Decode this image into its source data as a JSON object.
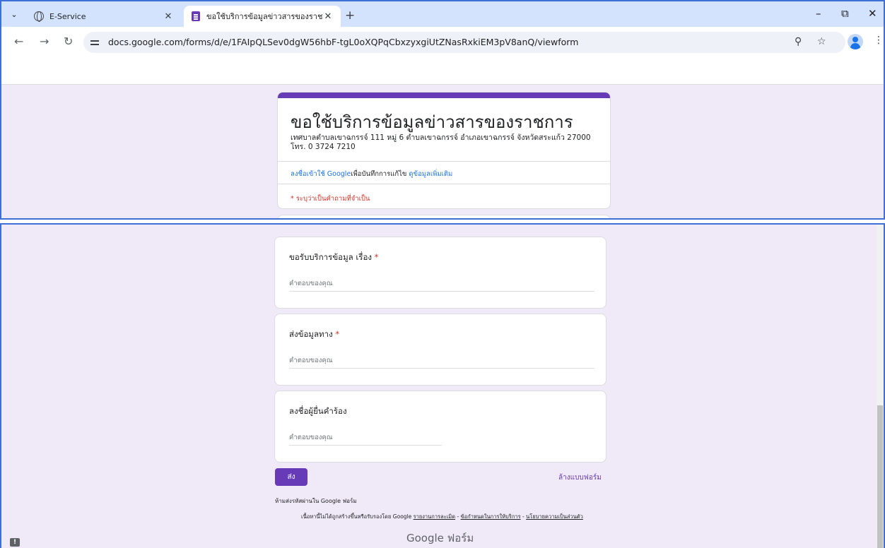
{
  "browser": {
    "tabs": [
      {
        "title": "E-Service",
        "icon": "globe-icon"
      },
      {
        "title": "ขอใช้บริการข้อมูลข่าวสารของราชการ",
        "icon": "forms-icon"
      }
    ],
    "new_tab": "+",
    "window_controls": {
      "minimize": "–",
      "restore": "⧉",
      "close": "✕"
    },
    "url": "docs.google.com/forms/d/e/1FAIpQLSev0dgW56hbF-tgL0oXQPqCbxzyxgiUtZNasRxkiEM3pV8anQ/viewform"
  },
  "form": {
    "title": "ขอใช้บริการข้อมูลข่าวสารของราชการ",
    "description_line1": "เทศบาลตำบลเขาฉกรรจ์  111 หมู่ 6 ตำบลเขาฉกรรจ์ อำเภอเขาฉกรรจ์ จังหวัดสระแก้ว 27000",
    "description_line2": "โทร. 0 3724 7210",
    "signin_link": "ลงชื่อเข้าใช้ Google",
    "signin_text": "เพื่อบันทึกการแก้ไข ",
    "learn_more": "ดูข้อมูลเพิ่มเติม",
    "required_note": "* ระบุว่าเป็นคำถามที่จำเป็น",
    "questions": [
      {
        "label": "ขอรับบริการข้อมูล เรื่อง",
        "required": "*",
        "placeholder": "คำตอบของคุณ"
      },
      {
        "label": "ส่งข้อมูลทาง",
        "required": "*",
        "placeholder": "คำตอบของคุณ"
      },
      {
        "label": "ลงชื่อผู้ยื่นคำร้อง",
        "required": "",
        "placeholder": "คำตอบของคุณ"
      }
    ],
    "submit": "ส่ง",
    "clear": "ล้างแบบฟอร์ม",
    "never_submit_passwords": "ห้ามส่งรหัสผ่านใน Google ฟอร์ม",
    "disclaimer": "เนื้อหานี้ไม่ได้ถูกสร้างขึ้นหรือรับรองโดย Google",
    "report_abuse": "รายงานการละเมิด",
    "terms": "ข้อกำหนดในการให้บริการ",
    "privacy": "นโยบายความเป็นส่วนตัว",
    "separator": " - ",
    "brand": "Google ฟอร์ม"
  },
  "colors": {
    "accent": "#673ab7",
    "background": "#f0eaf8",
    "required": "#d93025",
    "link": "#1a73e8"
  }
}
